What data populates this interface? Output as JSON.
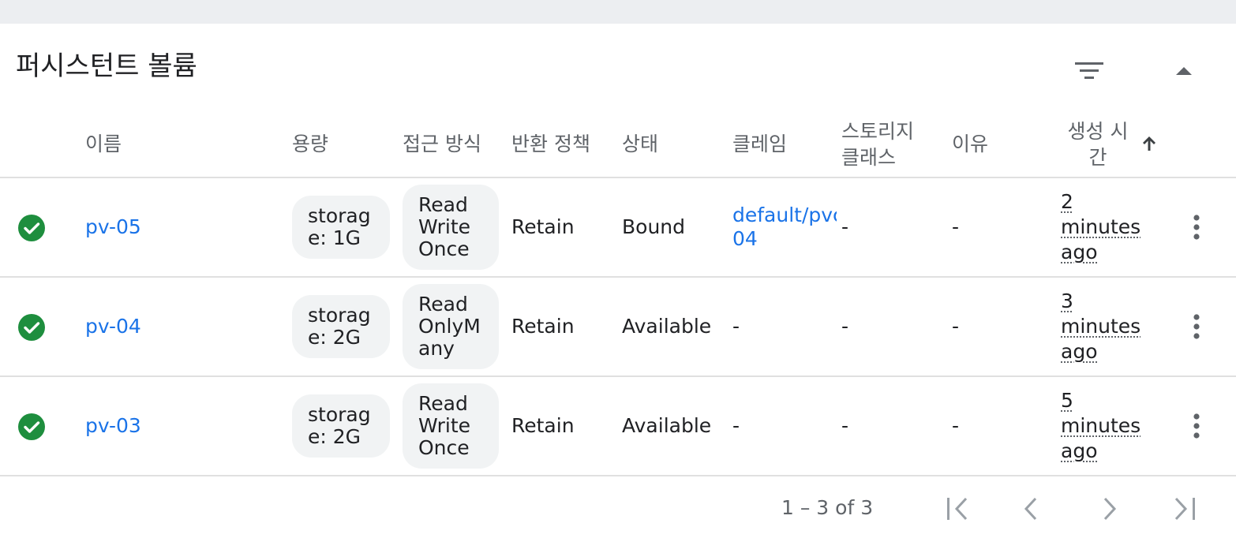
{
  "section": {
    "title": "퍼시스턴트 볼륨",
    "filter_icon": "filter-list-icon",
    "collapse_icon": "expand-less-icon"
  },
  "columns": {
    "name": "이름",
    "capacity": "용량",
    "access_modes": "접근 방식",
    "reclaim_policy": "반환 정책",
    "status": "상태",
    "claim": "클레임",
    "storage_class_line1": "스토리지",
    "storage_class_line2": "클래스",
    "reason": "이유",
    "created_line1": "생성 시",
    "created_line2": "간",
    "sort_icon": "arrow-upward-icon"
  },
  "rows": [
    {
      "status_icon": "check-circle-icon",
      "name": "pv-05",
      "capacity": "storage: 1G",
      "access_modes": "ReadWriteOnce",
      "reclaim_policy": "Retain",
      "status": "Bound",
      "claim_line1": "default/pvc-",
      "claim_line2": "04",
      "storage_class": "-",
      "reason": "-",
      "age_num": "2",
      "age_unit": "minutes",
      "age_suffix": "ago"
    },
    {
      "status_icon": "check-circle-icon",
      "name": "pv-04",
      "capacity": "storage: 2G",
      "access_modes": "ReadOnlyMany",
      "reclaim_policy": "Retain",
      "status": "Available",
      "claim": "-",
      "storage_class": "-",
      "reason": "-",
      "age_num": "3",
      "age_unit": "minutes",
      "age_suffix": "ago"
    },
    {
      "status_icon": "check-circle-icon",
      "name": "pv-03",
      "capacity": "storage: 2G",
      "access_modes": "ReadWriteOnce",
      "reclaim_policy": "Retain",
      "status": "Available",
      "claim": "-",
      "storage_class": "-",
      "reason": "-",
      "age_num": "5",
      "age_unit": "minutes",
      "age_suffix": "ago"
    }
  ],
  "pagination": {
    "range_label": "1 – 3 of 3",
    "first_icon": "first-page-icon",
    "prev_icon": "chevron-left-icon",
    "next_icon": "chevron-right-icon",
    "last_icon": "last-page-icon"
  },
  "colors": {
    "accent": "#1a73e8",
    "success": "#1e8e3e",
    "chip_bg": "#f1f3f4",
    "divider": "#e0e0e0"
  }
}
